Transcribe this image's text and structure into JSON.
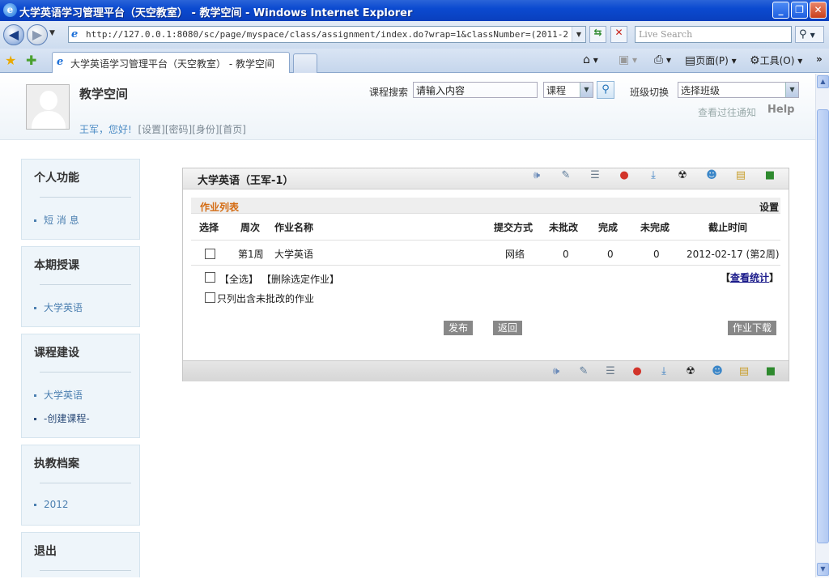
{
  "browser": {
    "window_title": "大学英语学习管理平台（天空教室） - 教学空间 - Windows Internet Explorer",
    "address": "http://127.0.0.1:8080/sc/page/myspace/class/assignment/index.do?wrap=1&classNumber=(2011-2012-1)-473",
    "search_placeholder": "Live Search",
    "tab_title": "大学英语学习管理平台（天空教室） - 教学空间",
    "page_menu": "页面(P)",
    "tools_menu": "工具(O)"
  },
  "header": {
    "space_title": "教学空间",
    "greeting": "王军，您好!",
    "links": [
      "[设置]",
      "[密码]",
      "[身份]",
      "[首页]"
    ],
    "search_label": "课程搜索",
    "search_value": "请输入内容",
    "search_scope": "课程",
    "class_label": "班级切换",
    "class_select": "选择班级",
    "notice_link": "查看过往通知",
    "help": "Help"
  },
  "sidebar": [
    {
      "title": "个人功能",
      "items": [
        "短 消 息"
      ]
    },
    {
      "title": "本期授课",
      "items": [
        "大学英语"
      ]
    },
    {
      "title": "课程建设",
      "items": [
        "大学英语",
        "-创建课程-"
      ]
    },
    {
      "title": "执教档案",
      "items": [
        "2012"
      ]
    },
    {
      "title": "退出",
      "items": []
    }
  ],
  "panel": {
    "title": "大学英语（王军-1）",
    "list_title": "作业列表",
    "settings": "设置",
    "columns": [
      "选择",
      "周次",
      "作业名称",
      "提交方式",
      "未批改",
      "完成",
      "未完成",
      "截止时间"
    ],
    "rows": [
      {
        "week": "第1周",
        "name": "大学英语",
        "method": "网络",
        "unmarked": "0",
        "done": "0",
        "undone": "0",
        "deadline": "2012-02-17 (第2周)"
      }
    ],
    "select_all": "【全选】",
    "delete_selected": "【删除选定作业】",
    "view_stats_prefix": "【",
    "view_stats": "查看统计",
    "view_stats_suffix": "】",
    "only_unmarked": "只列出含未批改的作业",
    "publish": "发布",
    "back": "返回",
    "download": "作业下载"
  },
  "toolbar_icons": [
    "speaker-icon",
    "write-icon",
    "chat-icon",
    "award-icon",
    "download-icon",
    "radiation-icon",
    "people-icon",
    "notepad-icon",
    "book-icon"
  ]
}
